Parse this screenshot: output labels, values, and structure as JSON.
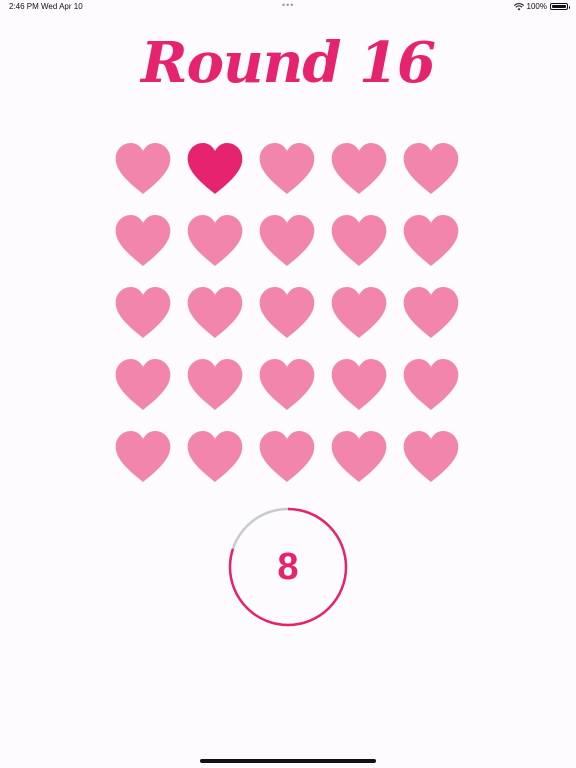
{
  "status_bar": {
    "time": "2:46 PM",
    "date": "Wed Apr 10",
    "battery": "100%",
    "multitask_dots": "•••"
  },
  "game": {
    "title": "Round 16",
    "grid": {
      "rows": 5,
      "columns": 5,
      "highlighted_index": 1
    },
    "timer": {
      "value": "8",
      "progress_fraction": 0.8
    }
  },
  "colors": {
    "accent": "#e6236e",
    "heart_normal": "#f285ab",
    "heart_highlight": "#e6236e",
    "timer_track": "#c7cbcd",
    "background": "#fdfbfd"
  }
}
